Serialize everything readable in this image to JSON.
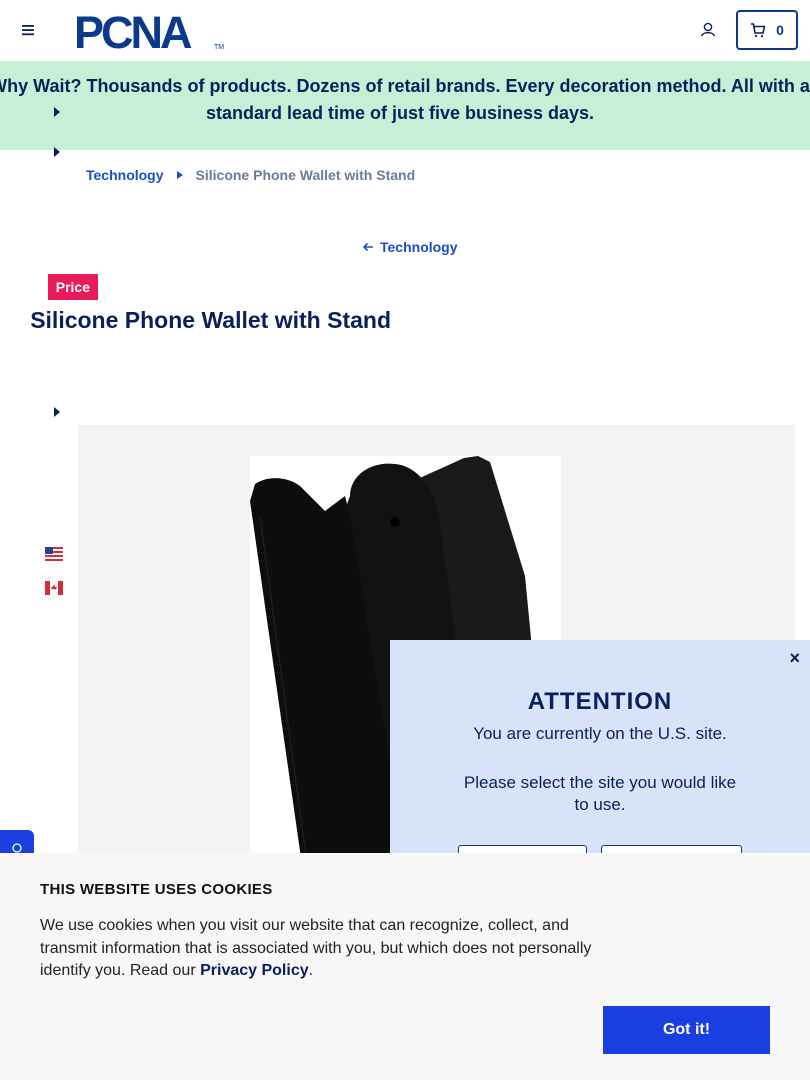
{
  "header": {
    "logo_text": "PCNA",
    "cart_count": "0"
  },
  "promo": {
    "text": "Why Wait? Thousands of products. Dozens of retail brands. Every decoration method. All with a standard lead time of just five business days."
  },
  "breadcrumb": {
    "items": [
      "Technology"
    ],
    "current": "Silicone Phone Wallet with Stand"
  },
  "back_link": {
    "label": "Technology"
  },
  "product": {
    "badge": "Price",
    "title": "Silicone Phone Wallet with Stand"
  },
  "modal": {
    "close": "×",
    "title": "ATTENTION",
    "message": "You are currently on the U.S. site.",
    "message2": "Please select the site you would like to use."
  },
  "cookie": {
    "title": "THIS WEBSITE USES COOKIES",
    "text_before": "We use cookies when you visit our website that can recognize, collect, and transmit information that is associated with you, but which does not personally identify you. Read our ",
    "link": "Privacy Policy",
    "text_after": ".",
    "button": "Got it!"
  },
  "colors": {
    "brand_navy": "#0b1f5c",
    "brand_blue": "#1a3fe0",
    "promo_bg": "#c6f0d6",
    "badge_bg": "#e81a5c",
    "modal_bg": "#d8e3f7"
  }
}
